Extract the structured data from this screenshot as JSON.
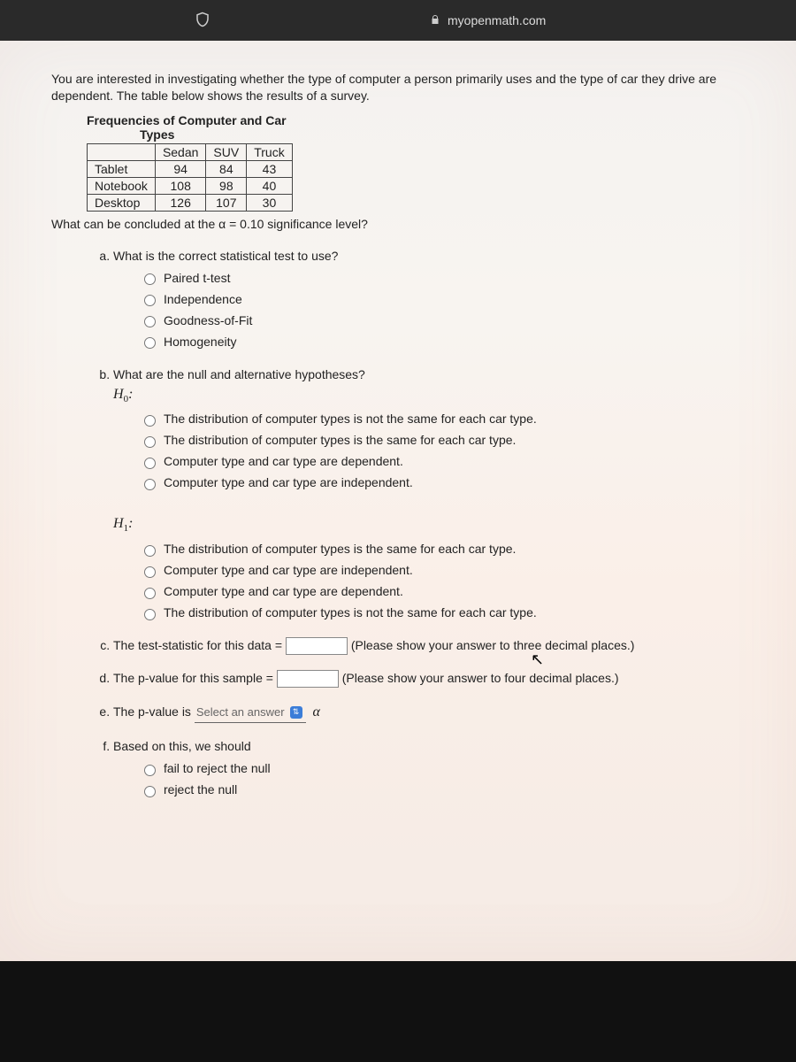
{
  "browser": {
    "domain": "myopenmath.com"
  },
  "intro": "You are interested in investigating whether the type of computer a person primarily uses and the type of car they drive are dependent. The table below shows the results of a survey.",
  "table": {
    "caption1": "Frequencies of Computer and Car",
    "caption2": "Types",
    "cols": [
      "Sedan",
      "SUV",
      "Truck"
    ],
    "rows": [
      {
        "label": "Tablet",
        "vals": [
          94,
          84,
          43
        ]
      },
      {
        "label": "Notebook",
        "vals": [
          108,
          98,
          40
        ]
      },
      {
        "label": "Desktop",
        "vals": [
          126,
          107,
          30
        ]
      }
    ]
  },
  "sig_line": "What can be concluded at the α = 0.10 significance level?",
  "q": {
    "a": {
      "prompt": "What is the correct statistical test to use?",
      "opts": [
        "Paired t-test",
        "Independence",
        "Goodness-of-Fit",
        "Homogeneity"
      ]
    },
    "b": {
      "prompt": "What are the null and alternative hypotheses?",
      "h0_label": "H",
      "h0_sub": "0",
      "h0_colon": ":",
      "h0_opts": [
        "The distribution of computer types is not the same for each car type.",
        "The distribution of computer types is the same for each car type.",
        "Computer type and car type are dependent.",
        "Computer type and car type are independent."
      ],
      "h1_label": "H",
      "h1_sub": "1",
      "h1_colon": ":",
      "h1_opts": [
        "The distribution of computer types is the same for each car type.",
        "Computer type and car type are independent.",
        "Computer type and car type are dependent.",
        "The distribution of computer types is not the same for each car type."
      ]
    },
    "c": {
      "prompt": "The test-statistic for this data =",
      "hint": "(Please show your answer to three decimal places.)"
    },
    "d": {
      "prompt": "The p-value for this sample =",
      "hint": "(Please show your answer to four decimal places.)"
    },
    "e": {
      "prompt": "The p-value is",
      "select_placeholder": "Select an answer",
      "alpha": "α"
    },
    "f": {
      "prompt": "Based on this, we should",
      "opts": [
        "fail to reject the null",
        "reject the null"
      ]
    }
  }
}
